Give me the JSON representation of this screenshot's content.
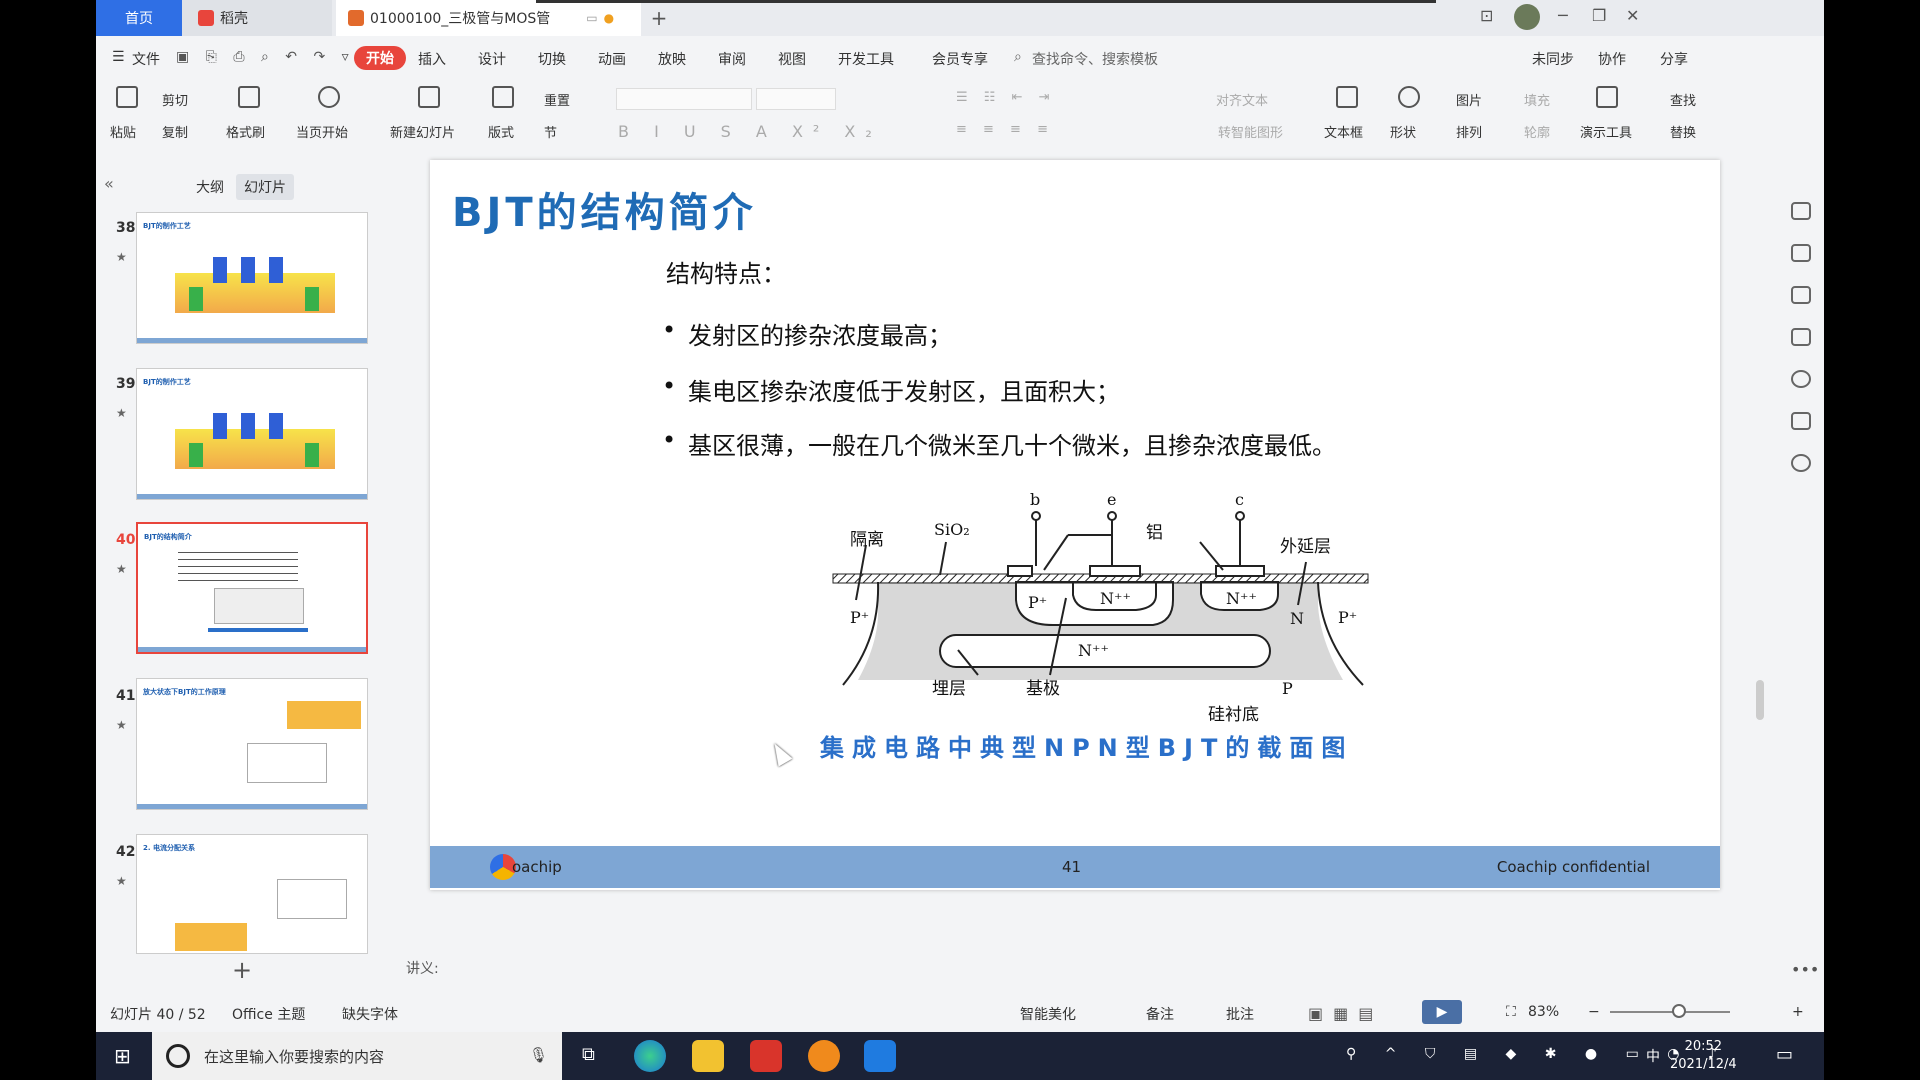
{
  "titlebar": {
    "tab_home": "首页",
    "tab_daoke": "稻壳",
    "tab_doc": "01000100_三极管与MOS管",
    "new_tab": "+"
  },
  "menu": {
    "file": "文件",
    "items": [
      "开始",
      "插入",
      "设计",
      "切换",
      "动画",
      "放映",
      "审阅",
      "视图",
      "开发工具",
      "会员专享"
    ],
    "search_placeholder": "查找命令、搜索模板",
    "sync": "未同步",
    "collab": "协作",
    "share": "分享"
  },
  "ribbon": {
    "paste": "粘贴",
    "cut": "剪切",
    "copy": "复制",
    "format_painter": "格式刷",
    "from_current": "当页开始",
    "new_slide": "新建幻灯片",
    "layout": "版式",
    "reset": "重置",
    "section": "节",
    "align_text": "对齐文本",
    "smart_shape": "转智能图形",
    "textbox": "文本框",
    "shape": "形状",
    "picture": "图片",
    "fill": "填充",
    "arrange": "排列",
    "outline": "轮廓",
    "present_tools": "演示工具",
    "find": "查找",
    "replace": "替换"
  },
  "leftpanel": {
    "tab_outline": "大纲",
    "tab_slides": "幻灯片",
    "thumbs": [
      {
        "num": "38",
        "title": "BJT的制作工艺"
      },
      {
        "num": "39",
        "title": "BJT的制作工艺"
      },
      {
        "num": "40",
        "title": "BJT的结构简介"
      },
      {
        "num": "41",
        "title": "放大状态下BJT的工作原理"
      },
      {
        "num": "42",
        "title": "2. 电流分配关系"
      }
    ],
    "add_label": "+"
  },
  "slide": {
    "title": "BJT的结构简介",
    "subtitle": "结构特点：",
    "bullets": [
      "发射区的掺杂浓度最高；",
      "集电区掺杂浓度低于发射区，且面积大；",
      "基区很薄，一般在几个微米至几十个微米，且掺杂浓度最低。"
    ],
    "diagram_labels": {
      "isolation": "隔离",
      "sio2": "SiO₂",
      "b": "b",
      "e": "e",
      "c": "c",
      "aluminum": "铝",
      "epi": "外延层",
      "p_plus_left": "P⁺",
      "p_plus_base": "P⁺",
      "n_pp_emitter": "N⁺⁺",
      "n_pp_collector": "N⁺⁺",
      "n": "N",
      "p_plus_right": "P⁺",
      "n_pp_buried": "N⁺⁺",
      "buried": "埋层",
      "base": "基极",
      "p": "P",
      "substrate": "硅衬底"
    },
    "caption": "集成电路中典型NPN型BJT的截面图",
    "footer": {
      "logo": "oachip",
      "page": "41",
      "confidential": "Coachip confidential"
    }
  },
  "notes": {
    "label": "讲义:"
  },
  "statusbar": {
    "slide_info": "幻灯片 40 / 52",
    "theme": "Office 主题",
    "missing_font": "缺失字体",
    "beautify": "智能美化",
    "notes": "备注",
    "comment": "批注",
    "zoom": "83%"
  },
  "taskbar": {
    "search_placeholder": "在这里输入你要搜索的内容",
    "time": "20:52",
    "date": "2021/12/4",
    "ime": "中"
  }
}
